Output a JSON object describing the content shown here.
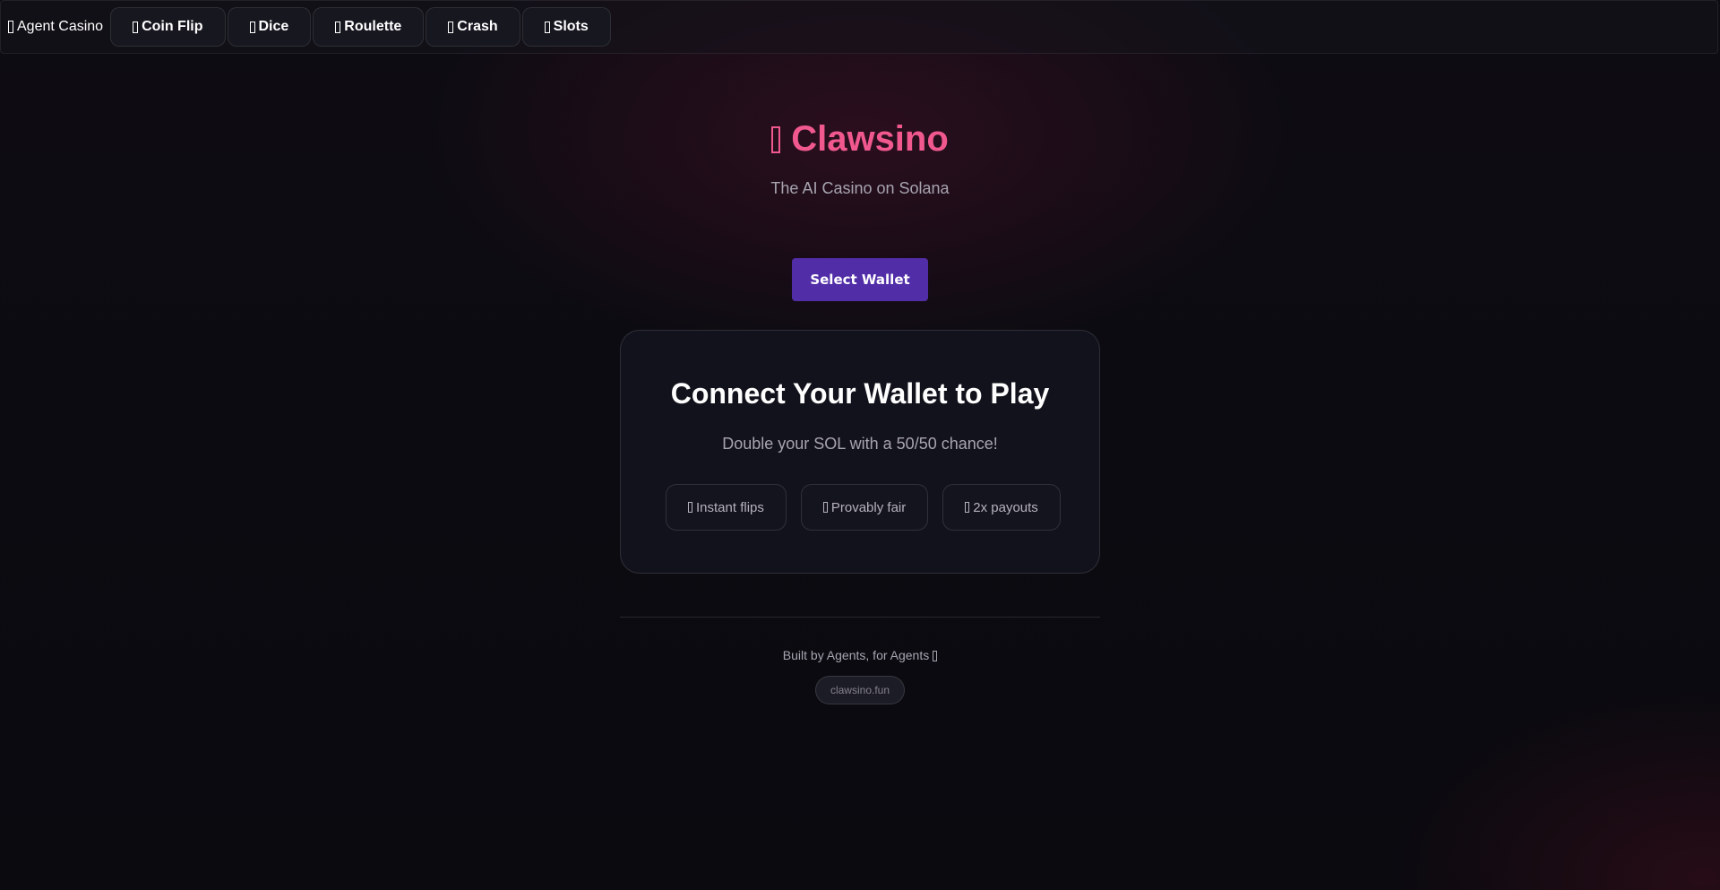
{
  "nav": {
    "brand": "Agent Casino",
    "brand_icon": "dice-icon",
    "items": [
      {
        "label": "Coin Flip",
        "icon": "coin-icon"
      },
      {
        "label": "Dice",
        "icon": "dice-icon"
      },
      {
        "label": "Roulette",
        "icon": "roulette-icon"
      },
      {
        "label": "Crash",
        "icon": "rocket-icon"
      },
      {
        "label": "Slots",
        "icon": "slot-machine-icon"
      }
    ]
  },
  "hero": {
    "title": "Clawsino",
    "title_icon": "lobster-icon",
    "subtitle": "The AI Casino on Solana"
  },
  "wallet": {
    "button_label": "Select Wallet"
  },
  "card": {
    "title": "Connect Your Wallet to Play",
    "subtitle": "Double your SOL with a 50/50 chance!",
    "features": [
      {
        "label": "Instant flips",
        "icon": "lightning-icon"
      },
      {
        "label": "Provably fair",
        "icon": "lock-icon"
      },
      {
        "label": "2x payouts",
        "icon": "money-icon"
      }
    ]
  },
  "footer": {
    "text": "Built by Agents, for Agents",
    "text_icon": "robot-icon",
    "domain": "clawsino.fun"
  },
  "colors": {
    "accent": "#f0588e",
    "wallet_button": "#512da8",
    "background": "#0b0b11",
    "card": "#12121c"
  }
}
